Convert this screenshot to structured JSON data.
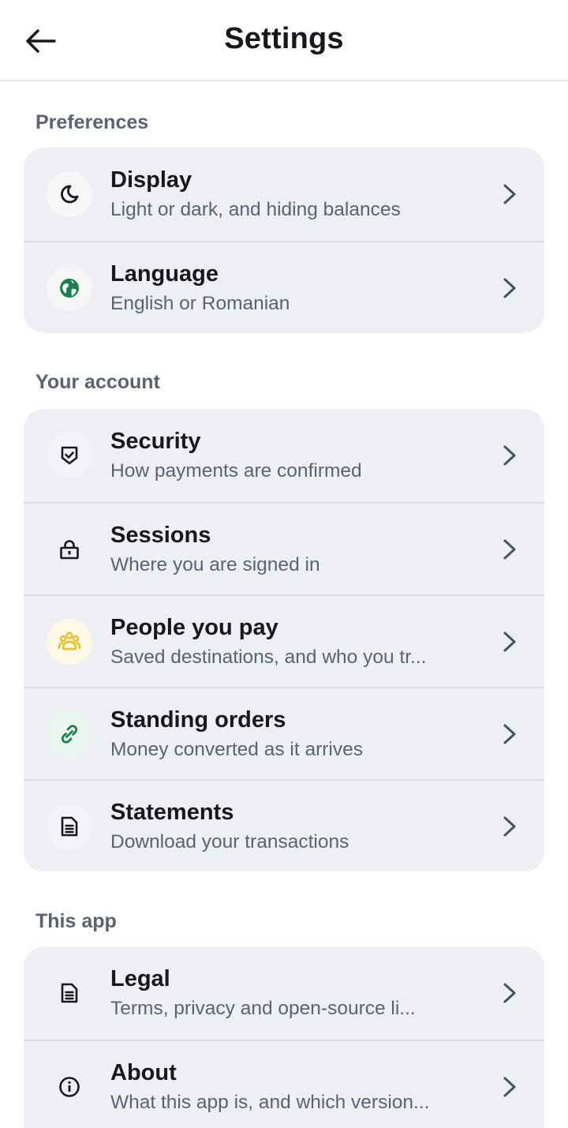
{
  "header": {
    "title": "Settings"
  },
  "sections": {
    "preferences": {
      "label": "Preferences",
      "items": [
        {
          "title": "Display",
          "subtitle": "Light or dark, and hiding balances",
          "icon": "moon-icon"
        },
        {
          "title": "Language",
          "subtitle": "English or Romanian",
          "icon": "globe-icon"
        }
      ]
    },
    "account": {
      "label": "Your account",
      "items": [
        {
          "title": "Security",
          "subtitle": "How payments are confirmed",
          "icon": "shield-check-icon"
        },
        {
          "title": "Sessions",
          "subtitle": "Where you are signed in",
          "icon": "lock-icon"
        },
        {
          "title": "People you pay",
          "subtitle": "Saved destinations, and who you tr...",
          "icon": "people-icon"
        },
        {
          "title": "Standing orders",
          "subtitle": "Money converted as it arrives",
          "icon": "link-icon"
        },
        {
          "title": "Statements",
          "subtitle": "Download your transactions",
          "icon": "document-icon"
        }
      ]
    },
    "app": {
      "label": "This app",
      "items": [
        {
          "title": "Legal",
          "subtitle": "Terms, privacy and open-source li...",
          "icon": "document-icon"
        },
        {
          "title": "About",
          "subtitle": "What this app is, and which version...",
          "icon": "info-icon"
        }
      ]
    }
  },
  "colors": {
    "accent_green": "#1a7f4b",
    "accent_yellow": "#e7c01f",
    "card_bg": "#eeeff3",
    "text_secondary": "#5b6270"
  }
}
